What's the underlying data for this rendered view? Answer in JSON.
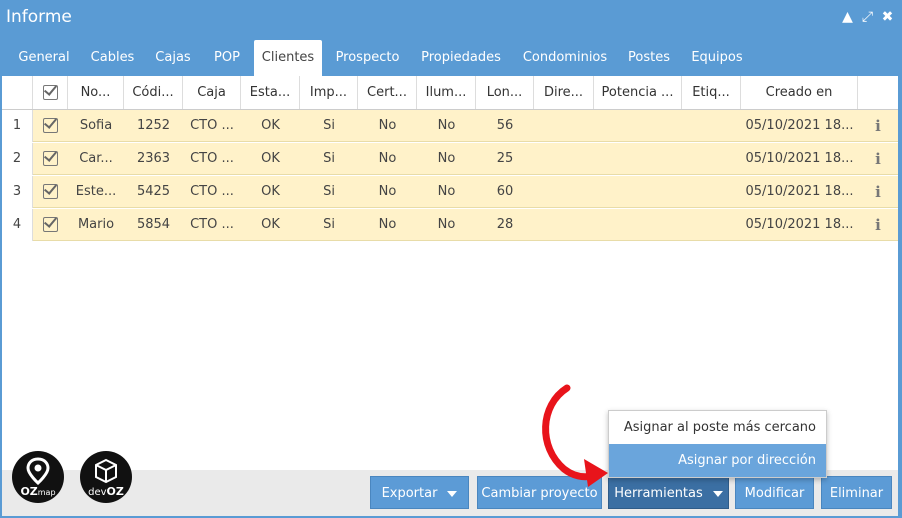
{
  "window": {
    "title": "Informe",
    "accent": "#5a9bd4"
  },
  "title_controls": [
    {
      "name": "collapse-icon",
      "glyph": "▲"
    },
    {
      "name": "maximize-icon",
      "glyph": "⤢"
    },
    {
      "name": "close-icon",
      "glyph": "✖"
    }
  ],
  "tabs": [
    "General",
    "Cables",
    "Cajas",
    "POP",
    "Clientes",
    "Prospecto",
    "Propiedades",
    "Condominios",
    "Postes",
    "Equipos"
  ],
  "active_tab": "Clientes",
  "table": {
    "columns": [
      "",
      "No...",
      "Códi...",
      "Caja",
      "Esta...",
      "Imp...",
      "Cert...",
      "Ilum...",
      "Lon...",
      "Dire...",
      "Potencia ...",
      "Etiq...",
      "Creado en",
      ""
    ],
    "rows": [
      {
        "n": "1",
        "nombre": "Sofia",
        "codigo": "1252",
        "caja": "CTO ...",
        "estado": "OK",
        "imp": "Si",
        "cert": "No",
        "ilum": "No",
        "lon": "56",
        "dir": "",
        "pot": "",
        "etiq": "",
        "creado": "05/10/2021 18..."
      },
      {
        "n": "2",
        "nombre": "Car...",
        "codigo": "2363",
        "caja": "CTO ...",
        "estado": "OK",
        "imp": "Si",
        "cert": "No",
        "ilum": "No",
        "lon": "25",
        "dir": "",
        "pot": "",
        "etiq": "",
        "creado": "05/10/2021 18..."
      },
      {
        "n": "3",
        "nombre": "Este...",
        "codigo": "5425",
        "caja": "CTO ...",
        "estado": "OK",
        "imp": "Si",
        "cert": "No",
        "ilum": "No",
        "lon": "60",
        "dir": "",
        "pot": "",
        "etiq": "",
        "creado": "05/10/2021 18..."
      },
      {
        "n": "4",
        "nombre": "Mario",
        "codigo": "5854",
        "caja": "CTO ...",
        "estado": "OK",
        "imp": "Si",
        "cert": "No",
        "ilum": "No",
        "lon": "28",
        "dir": "",
        "pot": "",
        "etiq": "",
        "creado": "05/10/2021 18..."
      }
    ],
    "row_color": "#fff2c9"
  },
  "dropdown": {
    "items": [
      "Asignar al poste más cercano",
      "Asignar por dirección"
    ],
    "highlighted": "Asignar por dirección"
  },
  "buttons": {
    "exportar": "Exportar",
    "cambiar_proyecto": "Cambiar proyecto",
    "herramientas": "Herramientas",
    "modificar": "Modificar",
    "eliminar": "Eliminar"
  },
  "logos": {
    "ozmap_a": "OZ",
    "ozmap_b": "map",
    "devoz_a": "dev",
    "devoz_b": "OZ"
  },
  "annotation": {
    "arrow_color": "#e8141b"
  }
}
